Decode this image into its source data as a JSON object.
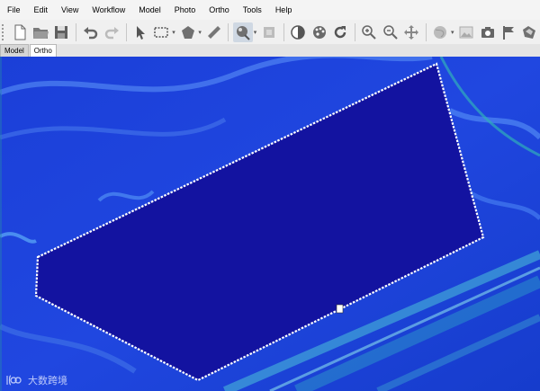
{
  "menu": [
    "File",
    "Edit",
    "View",
    "Workflow",
    "Model",
    "Photo",
    "Ortho",
    "Tools",
    "Help"
  ],
  "tabs": [
    "Model",
    "Ortho"
  ],
  "active_tab": "Ortho",
  "toolbar_icons": [
    "new-icon",
    "open-icon",
    "save-icon",
    "undo-icon",
    "redo-icon",
    "select-arrow-icon",
    "rectangle-selection-icon",
    "draw-polygon-icon",
    "ruler-icon",
    "brush-icon",
    "patch-icon",
    "contrast-icon",
    "palette-icon",
    "refresh-icon",
    "zoom-in-icon",
    "zoom-out-icon",
    "move-icon",
    "globe-icon",
    "image-icon",
    "camera-icon",
    "flag-icon",
    "shape-icon"
  ],
  "watermark": "大数跨境",
  "colors": {
    "ortho_background": "#1d3fd6",
    "polygon_fill": "#1313a0",
    "polygon_border": "#ffffff"
  }
}
